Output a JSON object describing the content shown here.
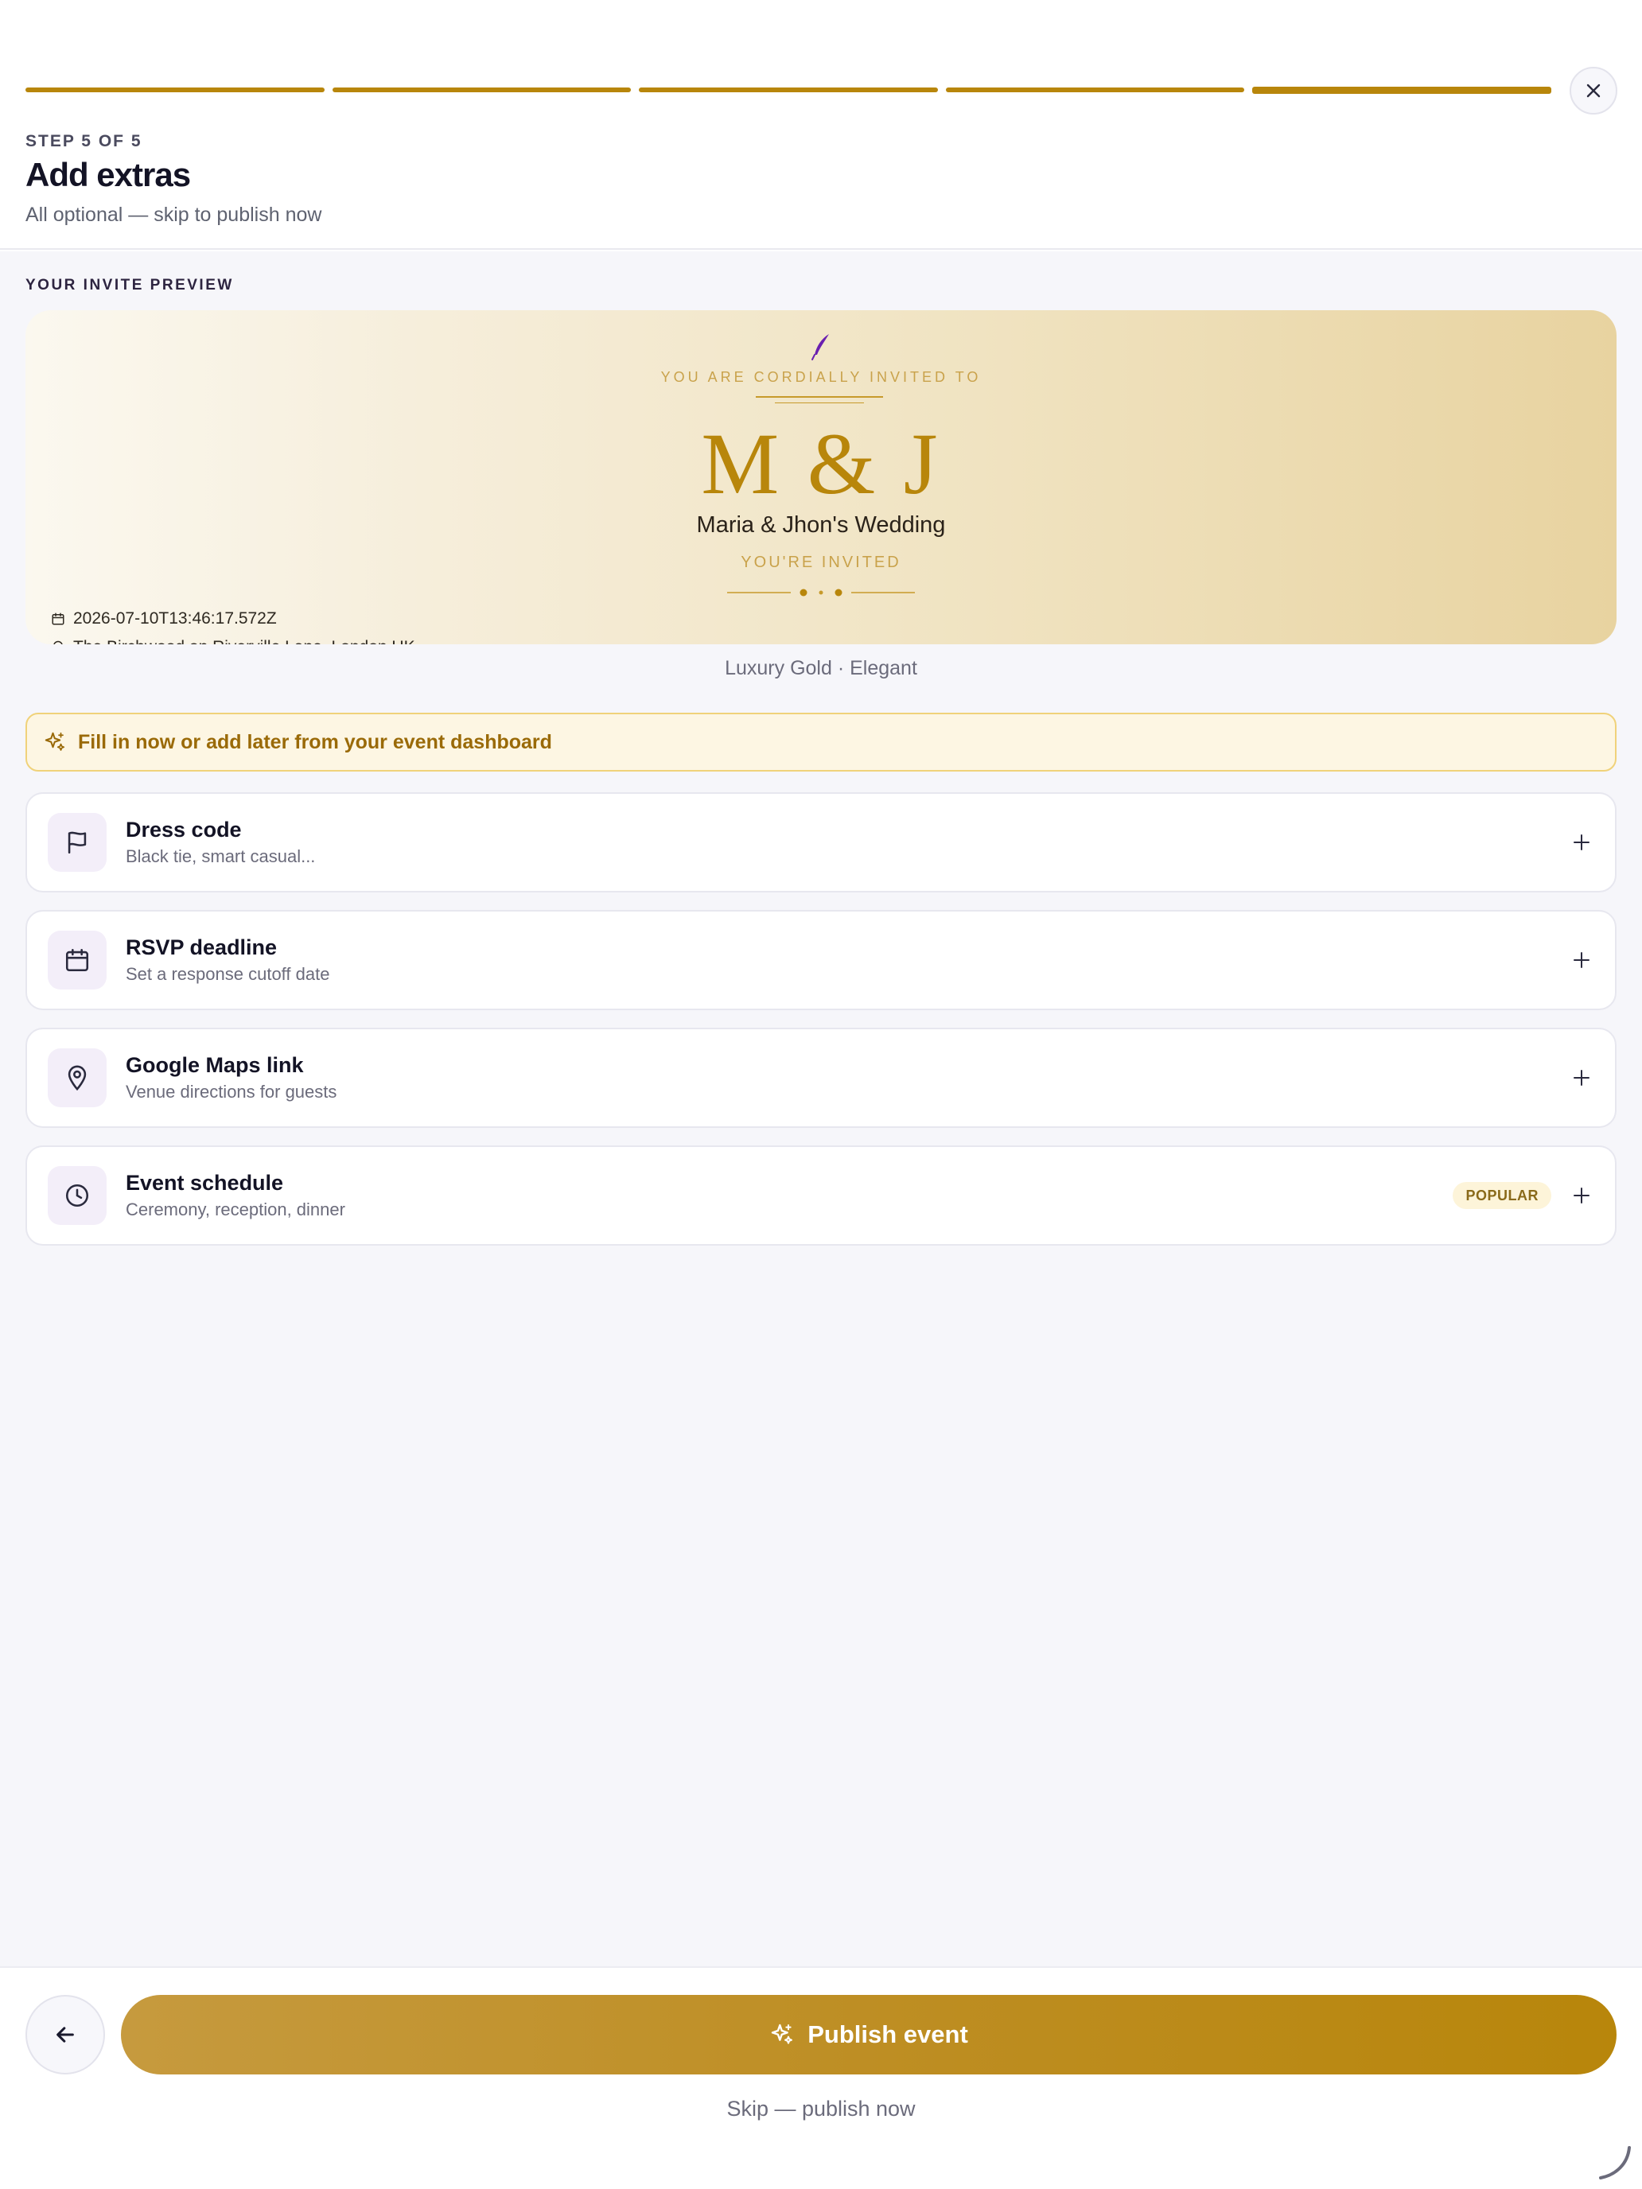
{
  "header": {
    "progress_steps": 5,
    "current_step": 5,
    "step_label": "STEP 5 OF 5",
    "title": "Add extras",
    "subtitle": "All optional — skip to publish now"
  },
  "preview": {
    "section_label": "YOUR INVITE PREVIEW",
    "cordially": "YOU ARE CORDIALLY INVITED TO",
    "monogram": "M & J",
    "event_name": "Maria & Jhon's Wedding",
    "youre_invited": "YOU'RE INVITED",
    "date": "2026-07-10T13:46:17.572Z",
    "venue": "The Birchwood on Riverville Lane, London UK",
    "template_caption": "Luxury Gold · Elegant"
  },
  "banner": {
    "text": "Fill in now or add later from your event dashboard"
  },
  "extras": [
    {
      "title": "Dress code",
      "description": "Black tie, smart casual...",
      "icon": "flag-icon"
    },
    {
      "title": "RSVP deadline",
      "description": "Set a response cutoff date",
      "icon": "calendar-icon"
    },
    {
      "title": "Google Maps link",
      "description": "Venue directions for guests",
      "icon": "map-pin-icon"
    },
    {
      "title": "Event schedule",
      "description": "Ceremony, reception, dinner",
      "icon": "clock-icon",
      "badge": "POPULAR"
    }
  ],
  "footer": {
    "publish_label": "Publish event",
    "skip_label": "Skip — publish now"
  },
  "colors": {
    "accent_gold": "#b8860b",
    "banner_bg": "#fdf6e3",
    "icon_bg": "#f3eef9",
    "feather": "#6a1fb0"
  }
}
